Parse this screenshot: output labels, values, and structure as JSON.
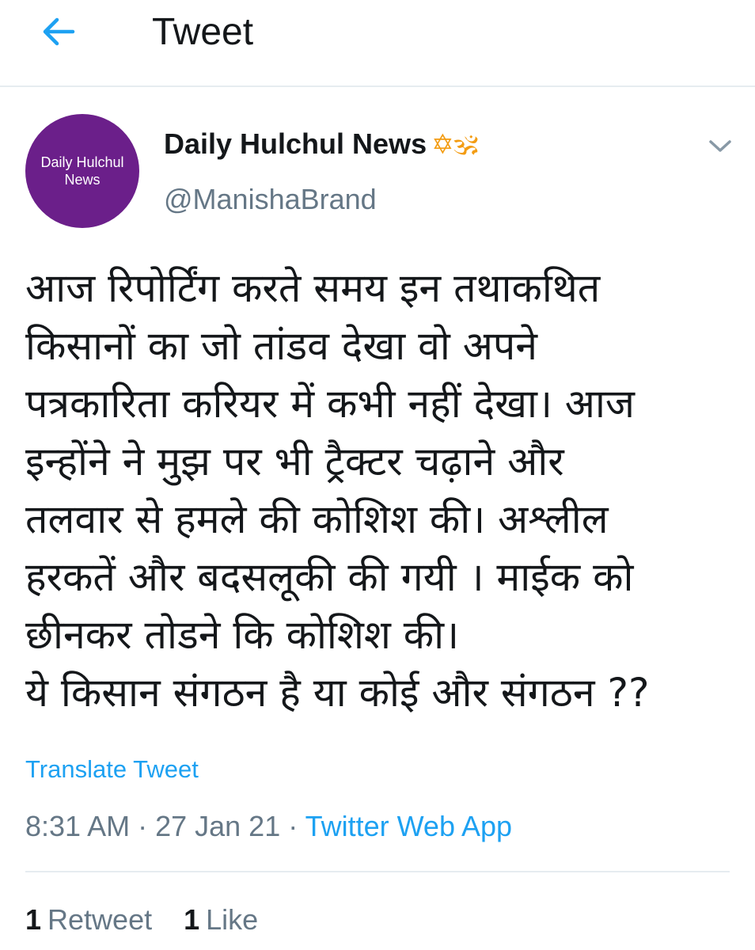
{
  "header": {
    "title": "Tweet",
    "back_icon": "arrow-left-icon",
    "accent_color": "#1da1f2"
  },
  "author": {
    "avatar_text": "Daily Hulchul News",
    "avatar_color": "#6b1f8a",
    "name": "Daily Hulchul News",
    "name_emojis": "✡🕉",
    "handle": "@ManishaBrand",
    "menu_icon": "chevron-down-icon"
  },
  "tweet": {
    "text": "आज रिपोर्टिंग करते समय इन तथाकथित\nकिसानों का जो तांडव देखा वो अपने\nपत्रकारिता करियर में कभी नहीं देखा। आज\nइन्होंने ने मुझ पर भी ट्रैक्टर चढ़ाने और\nतलवार से हमले की कोशिश की। अश्लील\nहरकतें और बदसलूकी की गयी । माईक को\nछीनकर तोडने कि कोशिश की।\nये किसान संगठन है या कोई और संगठन ??",
    "translate_label": "Translate Tweet"
  },
  "meta": {
    "time": "8:31 AM",
    "separator": " · ",
    "date": "27 Jan 21",
    "app": "Twitter Web App"
  },
  "stats": {
    "retweets_count": "1",
    "retweets_label": "Retweet",
    "likes_count": "1",
    "likes_label": "Like"
  }
}
